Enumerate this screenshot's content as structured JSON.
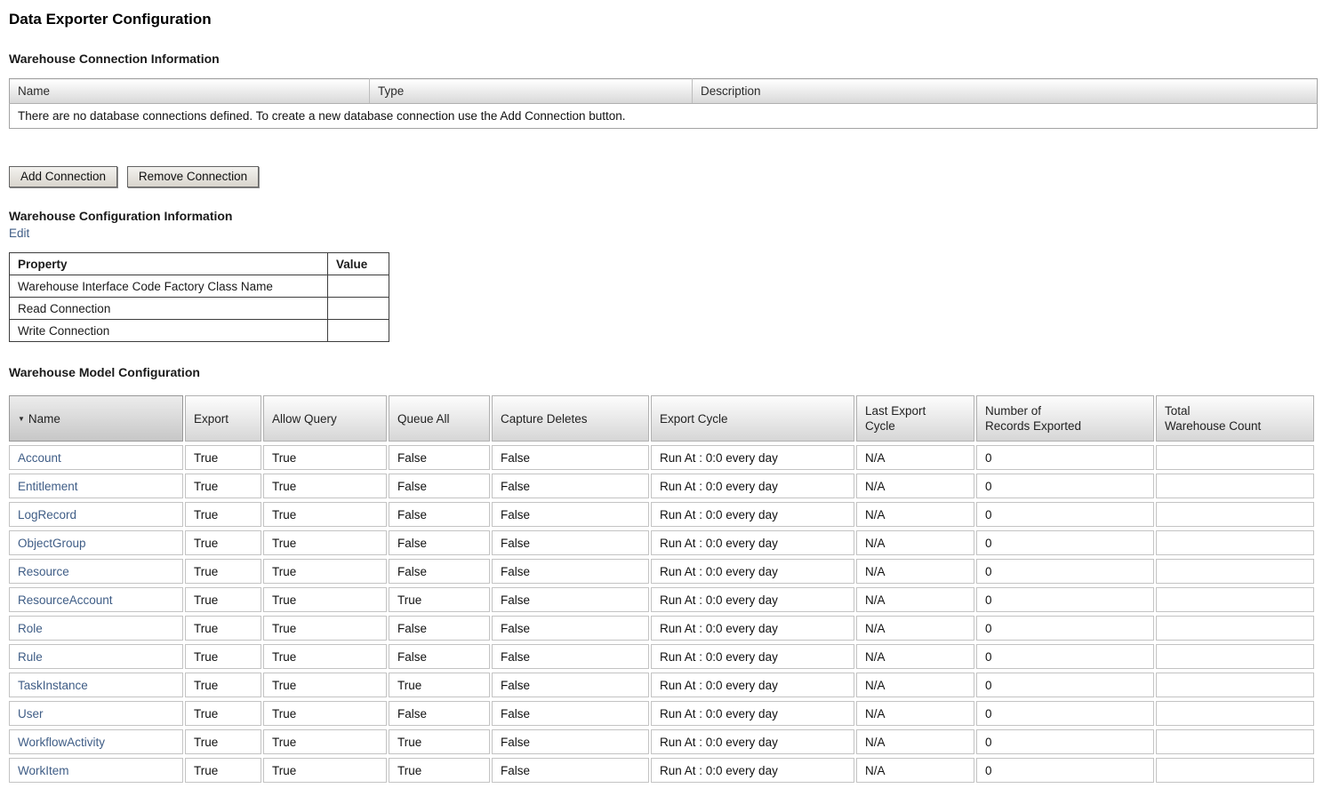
{
  "colors": {
    "link_blue": "#3f5d86"
  },
  "page": {
    "title": "Data Exporter Configuration"
  },
  "connection": {
    "heading": "Warehouse Connection Information",
    "columns": [
      "Name",
      "Type",
      "Description"
    ],
    "empty_message": "There are no database connections defined. To create a new database connection use the Add Connection button.",
    "add_button": "Add Connection",
    "remove_button": "Remove Connection"
  },
  "config": {
    "heading": "Warehouse Configuration Information",
    "edit_link": "Edit",
    "columns": [
      "Property",
      "Value"
    ],
    "rows": [
      {
        "property": "Warehouse Interface Code Factory Class Name",
        "value": ""
      },
      {
        "property": "Read Connection",
        "value": ""
      },
      {
        "property": "Write Connection",
        "value": ""
      }
    ]
  },
  "model": {
    "heading": "Warehouse Model Configuration",
    "sort_icon": "▼",
    "columns": [
      [
        "Name"
      ],
      [
        "Export"
      ],
      [
        "Allow Query"
      ],
      [
        "Queue All"
      ],
      [
        "Capture Deletes"
      ],
      [
        "Export Cycle"
      ],
      [
        "Last Export",
        "Cycle"
      ],
      [
        "Number of",
        "Records Exported"
      ],
      [
        "Total",
        "Warehouse Count"
      ]
    ],
    "rows": [
      {
        "name": "Account",
        "export": "True",
        "allow_query": "True",
        "queue_all": "False",
        "capture_deletes": "False",
        "export_cycle": "Run At : 0:0 every day",
        "last_export_cycle": "N/A",
        "records_exported": "0",
        "total_warehouse_count": ""
      },
      {
        "name": "Entitlement",
        "export": "True",
        "allow_query": "True",
        "queue_all": "False",
        "capture_deletes": "False",
        "export_cycle": "Run At : 0:0 every day",
        "last_export_cycle": "N/A",
        "records_exported": "0",
        "total_warehouse_count": ""
      },
      {
        "name": "LogRecord",
        "export": "True",
        "allow_query": "True",
        "queue_all": "False",
        "capture_deletes": "False",
        "export_cycle": "Run At : 0:0 every day",
        "last_export_cycle": "N/A",
        "records_exported": "0",
        "total_warehouse_count": ""
      },
      {
        "name": "ObjectGroup",
        "export": "True",
        "allow_query": "True",
        "queue_all": "False",
        "capture_deletes": "False",
        "export_cycle": "Run At : 0:0 every day",
        "last_export_cycle": "N/A",
        "records_exported": "0",
        "total_warehouse_count": ""
      },
      {
        "name": "Resource",
        "export": "True",
        "allow_query": "True",
        "queue_all": "False",
        "capture_deletes": "False",
        "export_cycle": "Run At : 0:0 every day",
        "last_export_cycle": "N/A",
        "records_exported": "0",
        "total_warehouse_count": ""
      },
      {
        "name": "ResourceAccount",
        "export": "True",
        "allow_query": "True",
        "queue_all": "True",
        "capture_deletes": "False",
        "export_cycle": "Run At : 0:0 every day",
        "last_export_cycle": "N/A",
        "records_exported": "0",
        "total_warehouse_count": ""
      },
      {
        "name": "Role",
        "export": "True",
        "allow_query": "True",
        "queue_all": "False",
        "capture_deletes": "False",
        "export_cycle": "Run At : 0:0 every day",
        "last_export_cycle": "N/A",
        "records_exported": "0",
        "total_warehouse_count": ""
      },
      {
        "name": "Rule",
        "export": "True",
        "allow_query": "True",
        "queue_all": "False",
        "capture_deletes": "False",
        "export_cycle": "Run At : 0:0 every day",
        "last_export_cycle": "N/A",
        "records_exported": "0",
        "total_warehouse_count": ""
      },
      {
        "name": "TaskInstance",
        "export": "True",
        "allow_query": "True",
        "queue_all": "True",
        "capture_deletes": "False",
        "export_cycle": "Run At : 0:0 every day",
        "last_export_cycle": "N/A",
        "records_exported": "0",
        "total_warehouse_count": ""
      },
      {
        "name": "User",
        "export": "True",
        "allow_query": "True",
        "queue_all": "False",
        "capture_deletes": "False",
        "export_cycle": "Run At : 0:0 every day",
        "last_export_cycle": "N/A",
        "records_exported": "0",
        "total_warehouse_count": ""
      },
      {
        "name": "WorkflowActivity",
        "export": "True",
        "allow_query": "True",
        "queue_all": "True",
        "capture_deletes": "False",
        "export_cycle": "Run At : 0:0 every day",
        "last_export_cycle": "N/A",
        "records_exported": "0",
        "total_warehouse_count": ""
      },
      {
        "name": "WorkItem",
        "export": "True",
        "allow_query": "True",
        "queue_all": "True",
        "capture_deletes": "False",
        "export_cycle": "Run At : 0:0 every day",
        "last_export_cycle": "N/A",
        "records_exported": "0",
        "total_warehouse_count": ""
      }
    ]
  }
}
